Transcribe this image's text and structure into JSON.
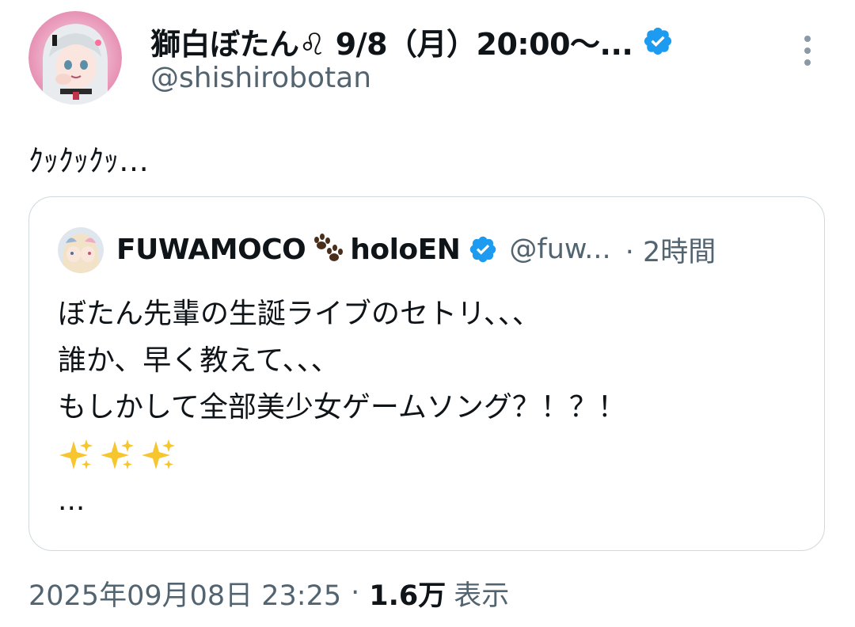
{
  "tweet": {
    "author": {
      "display_name": "獅白ぼたん♌ 9/8（月）20:00〜...",
      "handle": "@shishirobotan",
      "verified": true,
      "avatar_icon": "avatar-image"
    },
    "text": "ｸｯｸｯｸｯ…",
    "quoted": {
      "display_name": "FUWAMOCO",
      "display_name_suffix": "holoEN",
      "name_emoji": "paw-prints",
      "handle": "@fuw...",
      "time": "· 2時間",
      "lines": [
        "ぼたん先輩の生誕ライブのセトリ、、、",
        "誰か、早く教えて、、、",
        "もしかして全部美少女ゲームソング？！？！"
      ],
      "emoji_line": [
        "sparkles",
        "sparkles",
        "sparkles"
      ],
      "more": "..."
    },
    "meta": {
      "timestamp": "2025年09月08日 23:25",
      "separator": "·",
      "views_count": "1.6万",
      "views_label": "表示"
    }
  },
  "colors": {
    "text_primary": "#0f1419",
    "text_secondary": "#536471",
    "verified_blue": "#1d9bf0",
    "border": "#cfd9de"
  }
}
